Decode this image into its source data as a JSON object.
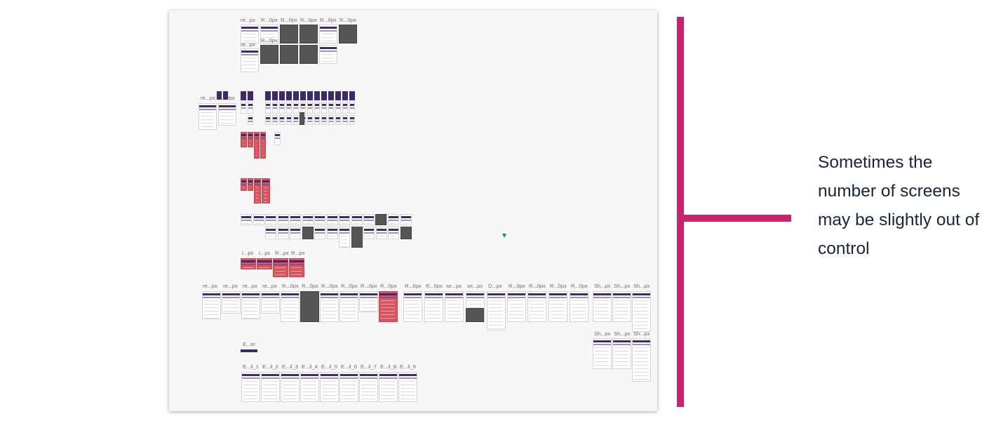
{
  "caption": "Sometimes the number of screens may be slightly out of control",
  "colors": {
    "accent_bar": "#c8236e",
    "caption_text": "#1b2438",
    "screen_header": "#3d2a6b",
    "error_screen": "#d95560",
    "dark_screen": "#555555"
  },
  "canvas": {
    "labels": {
      "row1_label_1": "re...px",
      "row1_label_2": "R...0px",
      "row1_label_3": "R...0px",
      "row1_label_4": "R...0px",
      "row1_label_5": "R...0px",
      "row1_label_6": "R...0px",
      "row2_label_1": "re...px",
      "row2_label_2": "R...0px",
      "left_label_1": "re...px",
      "left_label_2": "R...0px",
      "red_row_label_1": "r...px",
      "red_row_label_2": "r...px",
      "red_row_label_3": "R...px",
      "red_row_label_4": "R...px",
      "main_row": [
        "re...px",
        "re...px",
        "re...px",
        "re...px",
        "R...0px",
        "R...0px",
        "R...0px",
        "R...0px",
        "R...0px",
        "R...0px",
        "R...0px",
        "R...0px",
        "se...px",
        "se...px",
        "D...px",
        "R...0px",
        "R...0px",
        "R...0px",
        "R...0px",
        "Sh...px",
        "Sh...px",
        "Sh...px"
      ],
      "sh_row2": [
        "Sh...px",
        "Sh...px",
        "Sh...px"
      ],
      "email_header": "E...er",
      "email_row": [
        "E...il_1",
        "E...il_2",
        "E...il_3",
        "E...il_4",
        "E...il_5",
        "E...il_6",
        "E...il_7",
        "E...il_8",
        "E...il_9"
      ]
    }
  }
}
